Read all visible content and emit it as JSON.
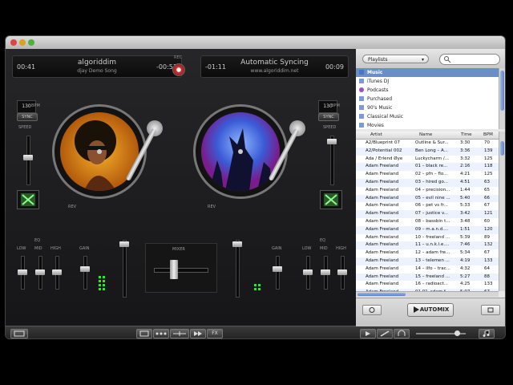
{
  "deckA": {
    "elapsed": "00:41",
    "title": "algoriddim",
    "subtitle": "djay Demo Song",
    "remaining": "-00:51",
    "bpm": "130",
    "bpm_unit": "BPM",
    "sync_label": "SYNC",
    "speed_label": "SPEED",
    "rev_label": "REV"
  },
  "deckB": {
    "elapsed": "-01:11",
    "title": "Automatic Syncing",
    "subtitle": "www.algoriddim.net",
    "remaining": "00:09",
    "bpm": "130",
    "bpm_unit": "BPM",
    "sync_label": "SYNC",
    "speed_label": "SPEED",
    "rev_label": "REV"
  },
  "rec_label": "REC",
  "eq": {
    "label": "EQ",
    "low": "LOW",
    "mid": "MID",
    "high": "HIGH",
    "gain": "GAIN"
  },
  "mixer_label": "MIXER",
  "toolbar": {
    "fx_label": "FX"
  },
  "browser": {
    "source_select": "Playlists",
    "sources": [
      {
        "label": "Music",
        "icon": "music-note-icon",
        "selected": true
      },
      {
        "label": "iTunes DJ",
        "icon": "itunes-dj-icon",
        "selected": false
      },
      {
        "label": "Podcasts",
        "icon": "podcast-icon",
        "selected": false
      },
      {
        "label": "Purchased",
        "icon": "playlist-icon",
        "selected": false
      },
      {
        "label": "90's Music",
        "icon": "playlist-icon",
        "selected": false
      },
      {
        "label": "Classical Music",
        "icon": "playlist-icon",
        "selected": false
      },
      {
        "label": "Movies",
        "icon": "playlist-icon",
        "selected": false
      }
    ],
    "columns": {
      "artist": "Artist",
      "name": "Name",
      "time": "Time",
      "bpm": "BPM"
    },
    "tracks": [
      {
        "artist": "A2/Blueprint 07",
        "name": "Outline & Sur...",
        "time": "3:30",
        "bpm": "70"
      },
      {
        "artist": "A2/Potential 002",
        "name": "Ben Long – A...",
        "time": "3:36",
        "bpm": "139"
      },
      {
        "artist": "Ada / Erlend Øye",
        "name": "Luckycharm /...",
        "time": "3:32",
        "bpm": "125"
      },
      {
        "artist": "Adam Freeland",
        "name": "01 – black re...",
        "time": "2:16",
        "bpm": "118"
      },
      {
        "artist": "Adam Freeland",
        "name": "02 – pfn – flo...",
        "time": "4:21",
        "bpm": "125"
      },
      {
        "artist": "Adam Freeland",
        "name": "03 – hired go...",
        "time": "4:51",
        "bpm": "63"
      },
      {
        "artist": "Adam Freeland",
        "name": "04 – precision...",
        "time": "1:44",
        "bpm": "65"
      },
      {
        "artist": "Adam Freeland",
        "name": "05 – evil nine ...",
        "time": "5:40",
        "bpm": "66"
      },
      {
        "artist": "Adam Freeland",
        "name": "06 – pet vs fr...",
        "time": "5:33",
        "bpm": "67"
      },
      {
        "artist": "Adam Freeland",
        "name": "07 – justice v...",
        "time": "3:42",
        "bpm": "121"
      },
      {
        "artist": "Adam Freeland",
        "name": "08 – bassbin t...",
        "time": "3:48",
        "bpm": "60"
      },
      {
        "artist": "Adam Freeland",
        "name": "09 – m.a.n.d....",
        "time": "1:51",
        "bpm": "120"
      },
      {
        "artist": "Adam Freeland",
        "name": "10 – freeland ...",
        "time": "5:39",
        "bpm": "89"
      },
      {
        "artist": "Adam Freeland",
        "name": "11 – u.n.k.l.e....",
        "time": "7:46",
        "bpm": "132"
      },
      {
        "artist": "Adam Freeland",
        "name": "12 – adam fre...",
        "time": "5:34",
        "bpm": "67"
      },
      {
        "artist": "Adam Freeland",
        "name": "13 – telemen ...",
        "time": "4:19",
        "bpm": "133"
      },
      {
        "artist": "Adam Freeland",
        "name": "14 – ilfo – trac...",
        "time": "4:32",
        "bpm": "64"
      },
      {
        "artist": "Adam Freeland",
        "name": "15 – freeland ...",
        "time": "5:27",
        "bpm": "88"
      },
      {
        "artist": "Adam Freeland",
        "name": "16 – radioact...",
        "time": "4:25",
        "bpm": "133"
      },
      {
        "artist": "Adam Freeland",
        "name": "01 01–adam f...",
        "time": "5:07",
        "bpm": "67"
      }
    ],
    "automix_label": "AUTOMIX"
  },
  "colors": {
    "source_selected": "#6a8fc6",
    "row_alt": "#edf3fe",
    "vu_green": "#22ee22"
  }
}
